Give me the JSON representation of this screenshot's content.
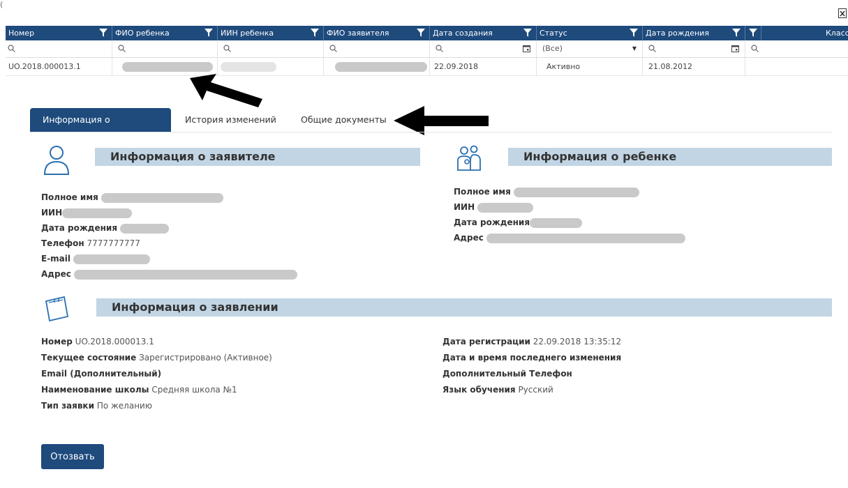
{
  "grid": {
    "columns": [
      {
        "label": "Номер"
      },
      {
        "label": "ФИО ребенка"
      },
      {
        "label": "ИИН ребенка"
      },
      {
        "label": "ФИО заявителя"
      },
      {
        "label": "Дата создания"
      },
      {
        "label": "Статус"
      },
      {
        "label": "Дата рождения"
      },
      {
        "label": ""
      },
      {
        "label": "Класс"
      }
    ],
    "status_filter": "(Все)",
    "row": {
      "number": "UO.2018.000013.1",
      "created": "22.09.2018",
      "status": "Активно",
      "birth": "21.08.2012"
    }
  },
  "tabs": [
    {
      "label": "Информация о заявлении"
    },
    {
      "label": "История изменений"
    },
    {
      "label": "Общие документы"
    }
  ],
  "applicant": {
    "title": "Информация о заявителе",
    "full_name_label": "Полное имя",
    "iin_label": "ИИН",
    "birth_label": "Дата рождения",
    "phone_label": "Телефон",
    "phone_value": "7777777777",
    "email_label": "E-mail",
    "address_label": "Адрес"
  },
  "child": {
    "title": "Информация о ребенке",
    "full_name_label": "Полное имя",
    "iin_label": "ИИН",
    "birth_label": "Дата рождения",
    "address_label": "Адрес"
  },
  "application": {
    "title": "Информация о заявлении",
    "number_label": "Номер",
    "number_value": "UO.2018.000013.1",
    "state_label": "Текущее состояние",
    "state_value": "Зарегистрировано (Активное)",
    "email_label": "Email (Дополнительный)",
    "school_label": "Наименование школы",
    "school_value": "Средняя школа №1",
    "type_label": "Тип заявки",
    "type_value": "По желанию",
    "reg_label": "Дата регистрации",
    "reg_value": "22.09.2018 13:35:12",
    "last_change_label": "Дата и время последнего изменения",
    "extra_phone_label": "Дополнительный Телефон",
    "language_label": "Язык обучения",
    "language_value": "Русский"
  },
  "actions": {
    "revoke_label": "Отозвать"
  }
}
